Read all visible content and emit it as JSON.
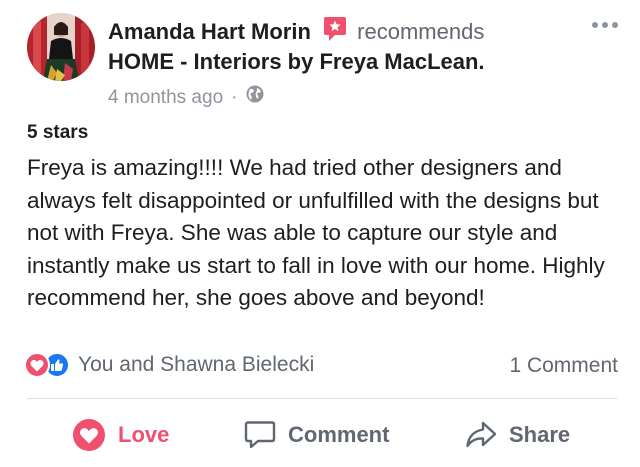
{
  "post": {
    "author_name": "Amanda Hart Morin",
    "recommends_text": "recommends",
    "page_name": "HOME - Interiors by Freya MacLean.",
    "timestamp": "4 months ago",
    "separator": "·",
    "privacy_icon": "globe-icon",
    "rating_text": "5 stars",
    "review_text": "Freya is amazing!!!! We had tried other designers and always felt disappointed or unfulfilled with the designs but not with Freya. She was able to capture our style and instantly make us start to fall in love with our home. Highly recommend her, she goes above and beyond!"
  },
  "reactions": {
    "icons": [
      "love-reaction-icon",
      "like-reaction-icon"
    ],
    "names": "You and Shawna Bielecki",
    "comment_count": "1 Comment"
  },
  "actions": {
    "love_label": "Love",
    "comment_label": "Comment",
    "share_label": "Share"
  },
  "colors": {
    "love": "#f0506e",
    "like": "#1877f2",
    "muted_text": "#606770",
    "light_text": "#90949c",
    "recommend_badge": "#f0506e"
  }
}
